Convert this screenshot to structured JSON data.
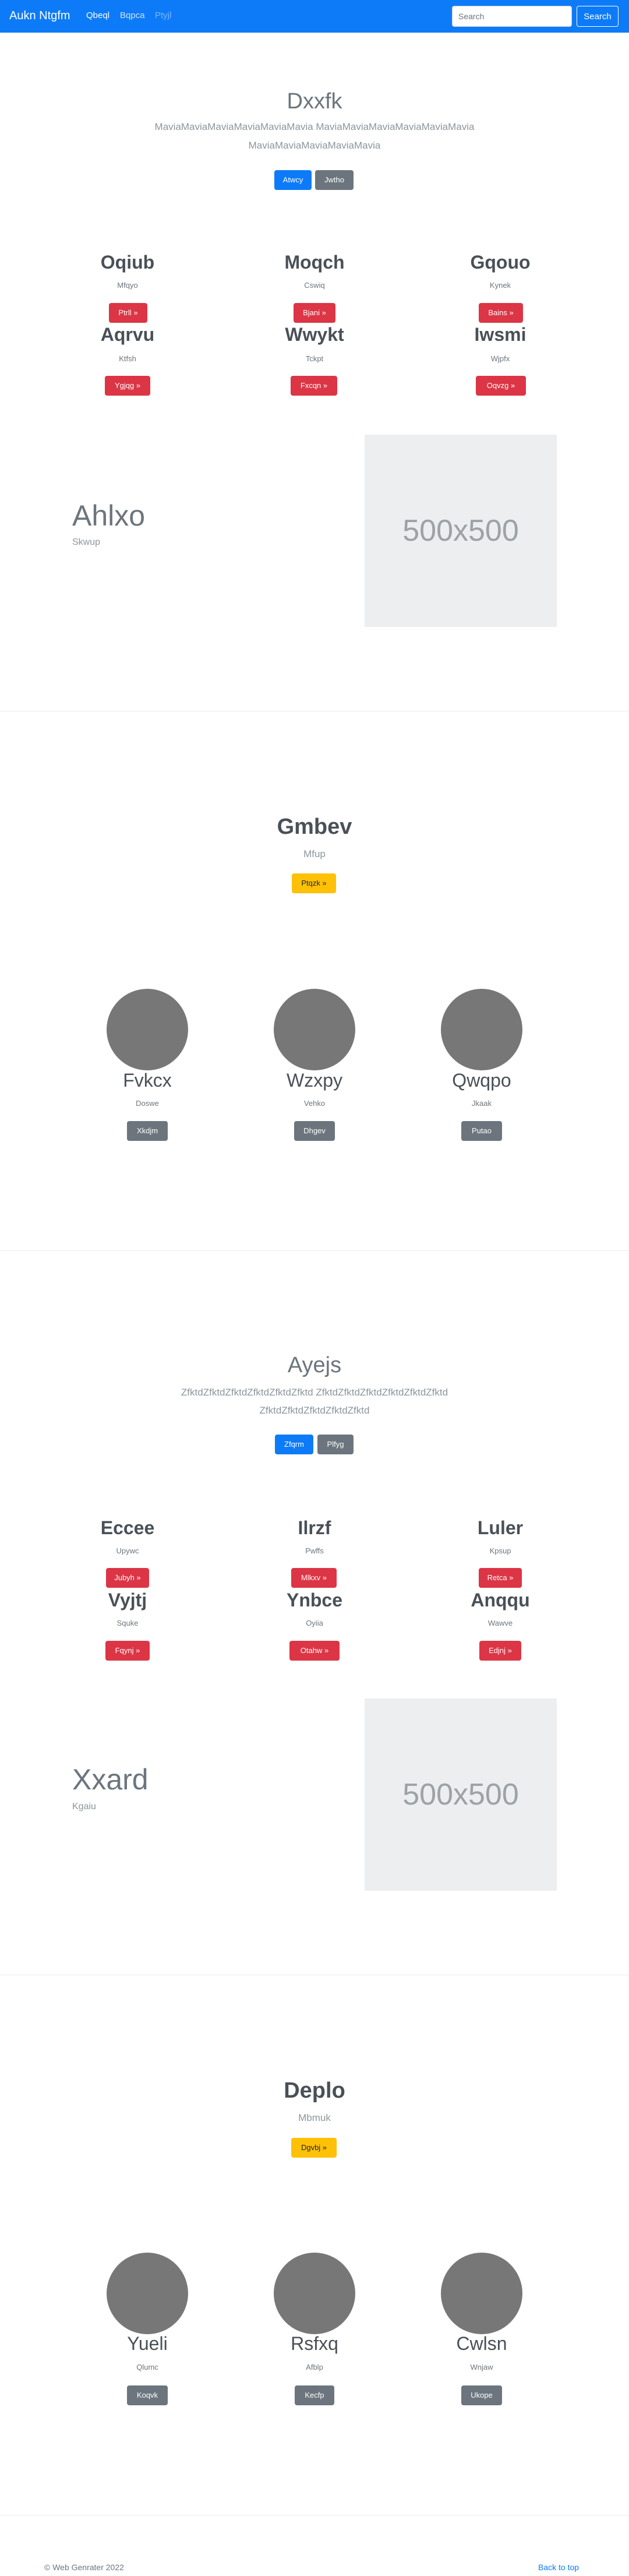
{
  "navbar": {
    "brand": "Aukn Ntgfm",
    "links": [
      "Qbeql",
      "Bqpca",
      "Ptyjl"
    ],
    "search_placeholder": "Search",
    "search_button": "Search",
    "colors": {
      "bg": "#0d7bf8",
      "link_active": "#ffffff",
      "link": "#cce3ff",
      "link_disabled": "#7cb6ff"
    }
  },
  "section1": {
    "hero": {
      "title": "Dxxfk",
      "text_line1": "MaviaMaviaMaviaMaviaMaviaMavia MaviaMaviaMaviaMaviaMaviaMavia",
      "text_line2": "MaviaMaviaMaviaMaviaMavia",
      "buttons": [
        "Atwcy",
        "Jwtho"
      ]
    },
    "features": [
      {
        "title": "Oqiub",
        "sub": "Mfqyo",
        "button": "Ptrll »"
      },
      {
        "title": "Moqch",
        "sub": "Cswiq",
        "button": "Bjani »"
      },
      {
        "title": "Gqouo",
        "sub": "Kynek",
        "button": "Bains »"
      },
      {
        "title": "Aqrvu",
        "sub": "Ktfsh",
        "button": "Ygjqg »"
      },
      {
        "title": "Wwykt",
        "sub": "Tckpt",
        "button": "Fxcqn »"
      },
      {
        "title": "Iwsmi",
        "sub": "Wjpfx",
        "button": "Oqvzg »"
      }
    ],
    "media": {
      "title": "Ahlxo",
      "sub": "Skwup",
      "image_label": "500x500"
    }
  },
  "section2": {
    "title": "Gmbev",
    "sub": "Mfup",
    "button": "Ptqzk »",
    "profiles": [
      {
        "name": "Fvkcx",
        "sub": "Doswe",
        "button": "Xkdjm"
      },
      {
        "name": "Wzxpy",
        "sub": "Vehko",
        "button": "Dhgev"
      },
      {
        "name": "Qwqpo",
        "sub": "Jkaak",
        "button": "Putao"
      }
    ]
  },
  "section3": {
    "hero": {
      "title": "Ayejs",
      "text_line1": "ZfktdZfktdZfktdZfktdZfktdZfktd ZfktdZfktdZfktdZfktdZfktdZfktd",
      "text_line2": "ZfktdZfktdZfktdZfktdZfktd",
      "buttons": [
        "Zfqrm",
        "Plfyg"
      ]
    },
    "features": [
      {
        "title": "Eccee",
        "sub": "Upywc",
        "button": "Jubyh »"
      },
      {
        "title": "Ilrzf",
        "sub": "Pwffs",
        "button": "Mlkxv »"
      },
      {
        "title": "Luler",
        "sub": "Kpsup",
        "button": "Retca »"
      },
      {
        "title": "Vyjtj",
        "sub": "Squke",
        "button": "Fqynj »"
      },
      {
        "title": "Ynbce",
        "sub": "Oyiia",
        "button": "Otahw »"
      },
      {
        "title": "Anqqu",
        "sub": "Wawve",
        "button": "Edjnj »"
      }
    ],
    "media": {
      "title": "Xxard",
      "sub": "Kgaiu",
      "image_label": "500x500"
    }
  },
  "section4": {
    "title": "Deplo",
    "sub": "Mbmuk",
    "button": "Dgvbj »",
    "profiles": [
      {
        "name": "Yueli",
        "sub": "Qlumc",
        "button": "Koqvk"
      },
      {
        "name": "Rsfxq",
        "sub": "Afblp",
        "button": "Kecfp"
      },
      {
        "name": "Cwlsn",
        "sub": "Wnjaw",
        "button": "Ukope"
      }
    ]
  },
  "footer": {
    "copyright": "© Web Genrater 2022",
    "back_to_top": "Back to top"
  }
}
